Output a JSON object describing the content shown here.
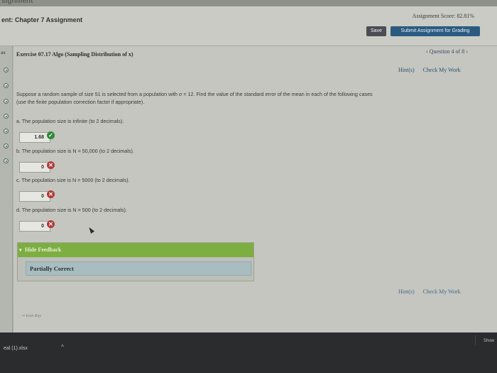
{
  "top_strip_text": "signment",
  "header": {
    "assignment_title": "ent: Chapter 7 Assignment",
    "assignment_score": "Assignment Score: 82.81%",
    "save_label": "Save",
    "submit_label": "Submit Assignment for Grading"
  },
  "sidebar": {
    "label": "as",
    "question_dots": 6
  },
  "exercise": {
    "title": "Exercise 07.17 Algo (Sampling Distribution of x)",
    "question_nav": "‹ Question 4 of 8 ›",
    "hints_label": "Hint(s)",
    "check_label": "Check My Work",
    "question_line1": "Suppose a random sample of size 51 is selected from a population with σ = 12. Find the value of the standard error of the mean in each of the following cases",
    "question_line2": "(use the finite population correction factor if appropriate).",
    "parts": [
      {
        "label": "a. The population size is infinite (to 2 decimals).",
        "answer": "1.68",
        "status": "correct"
      },
      {
        "label": "b. The population size is N = 50,000 (to 2 decimals).",
        "answer": "0",
        "status": "incorrect"
      },
      {
        "label": "c. The population size is N = 5000 (to 2 decimals).",
        "answer": "0",
        "status": "incorrect"
      },
      {
        "label": "d. The population size is N = 500 (to 2 decimals).",
        "answer": "0",
        "status": "incorrect"
      }
    ],
    "feedback_header": "Hide Feedback",
    "feedback_body": "Partially Correct",
    "icon_key": "Icon Key"
  },
  "taskbar": {
    "download_name": "eal (1).xlsx",
    "chevron": "^",
    "show_all": "Show"
  },
  "colors": {
    "submit": "#2b5a80",
    "feedback_green": "#7cae41",
    "correct": "#2f8a3d",
    "incorrect": "#b33a3a"
  }
}
